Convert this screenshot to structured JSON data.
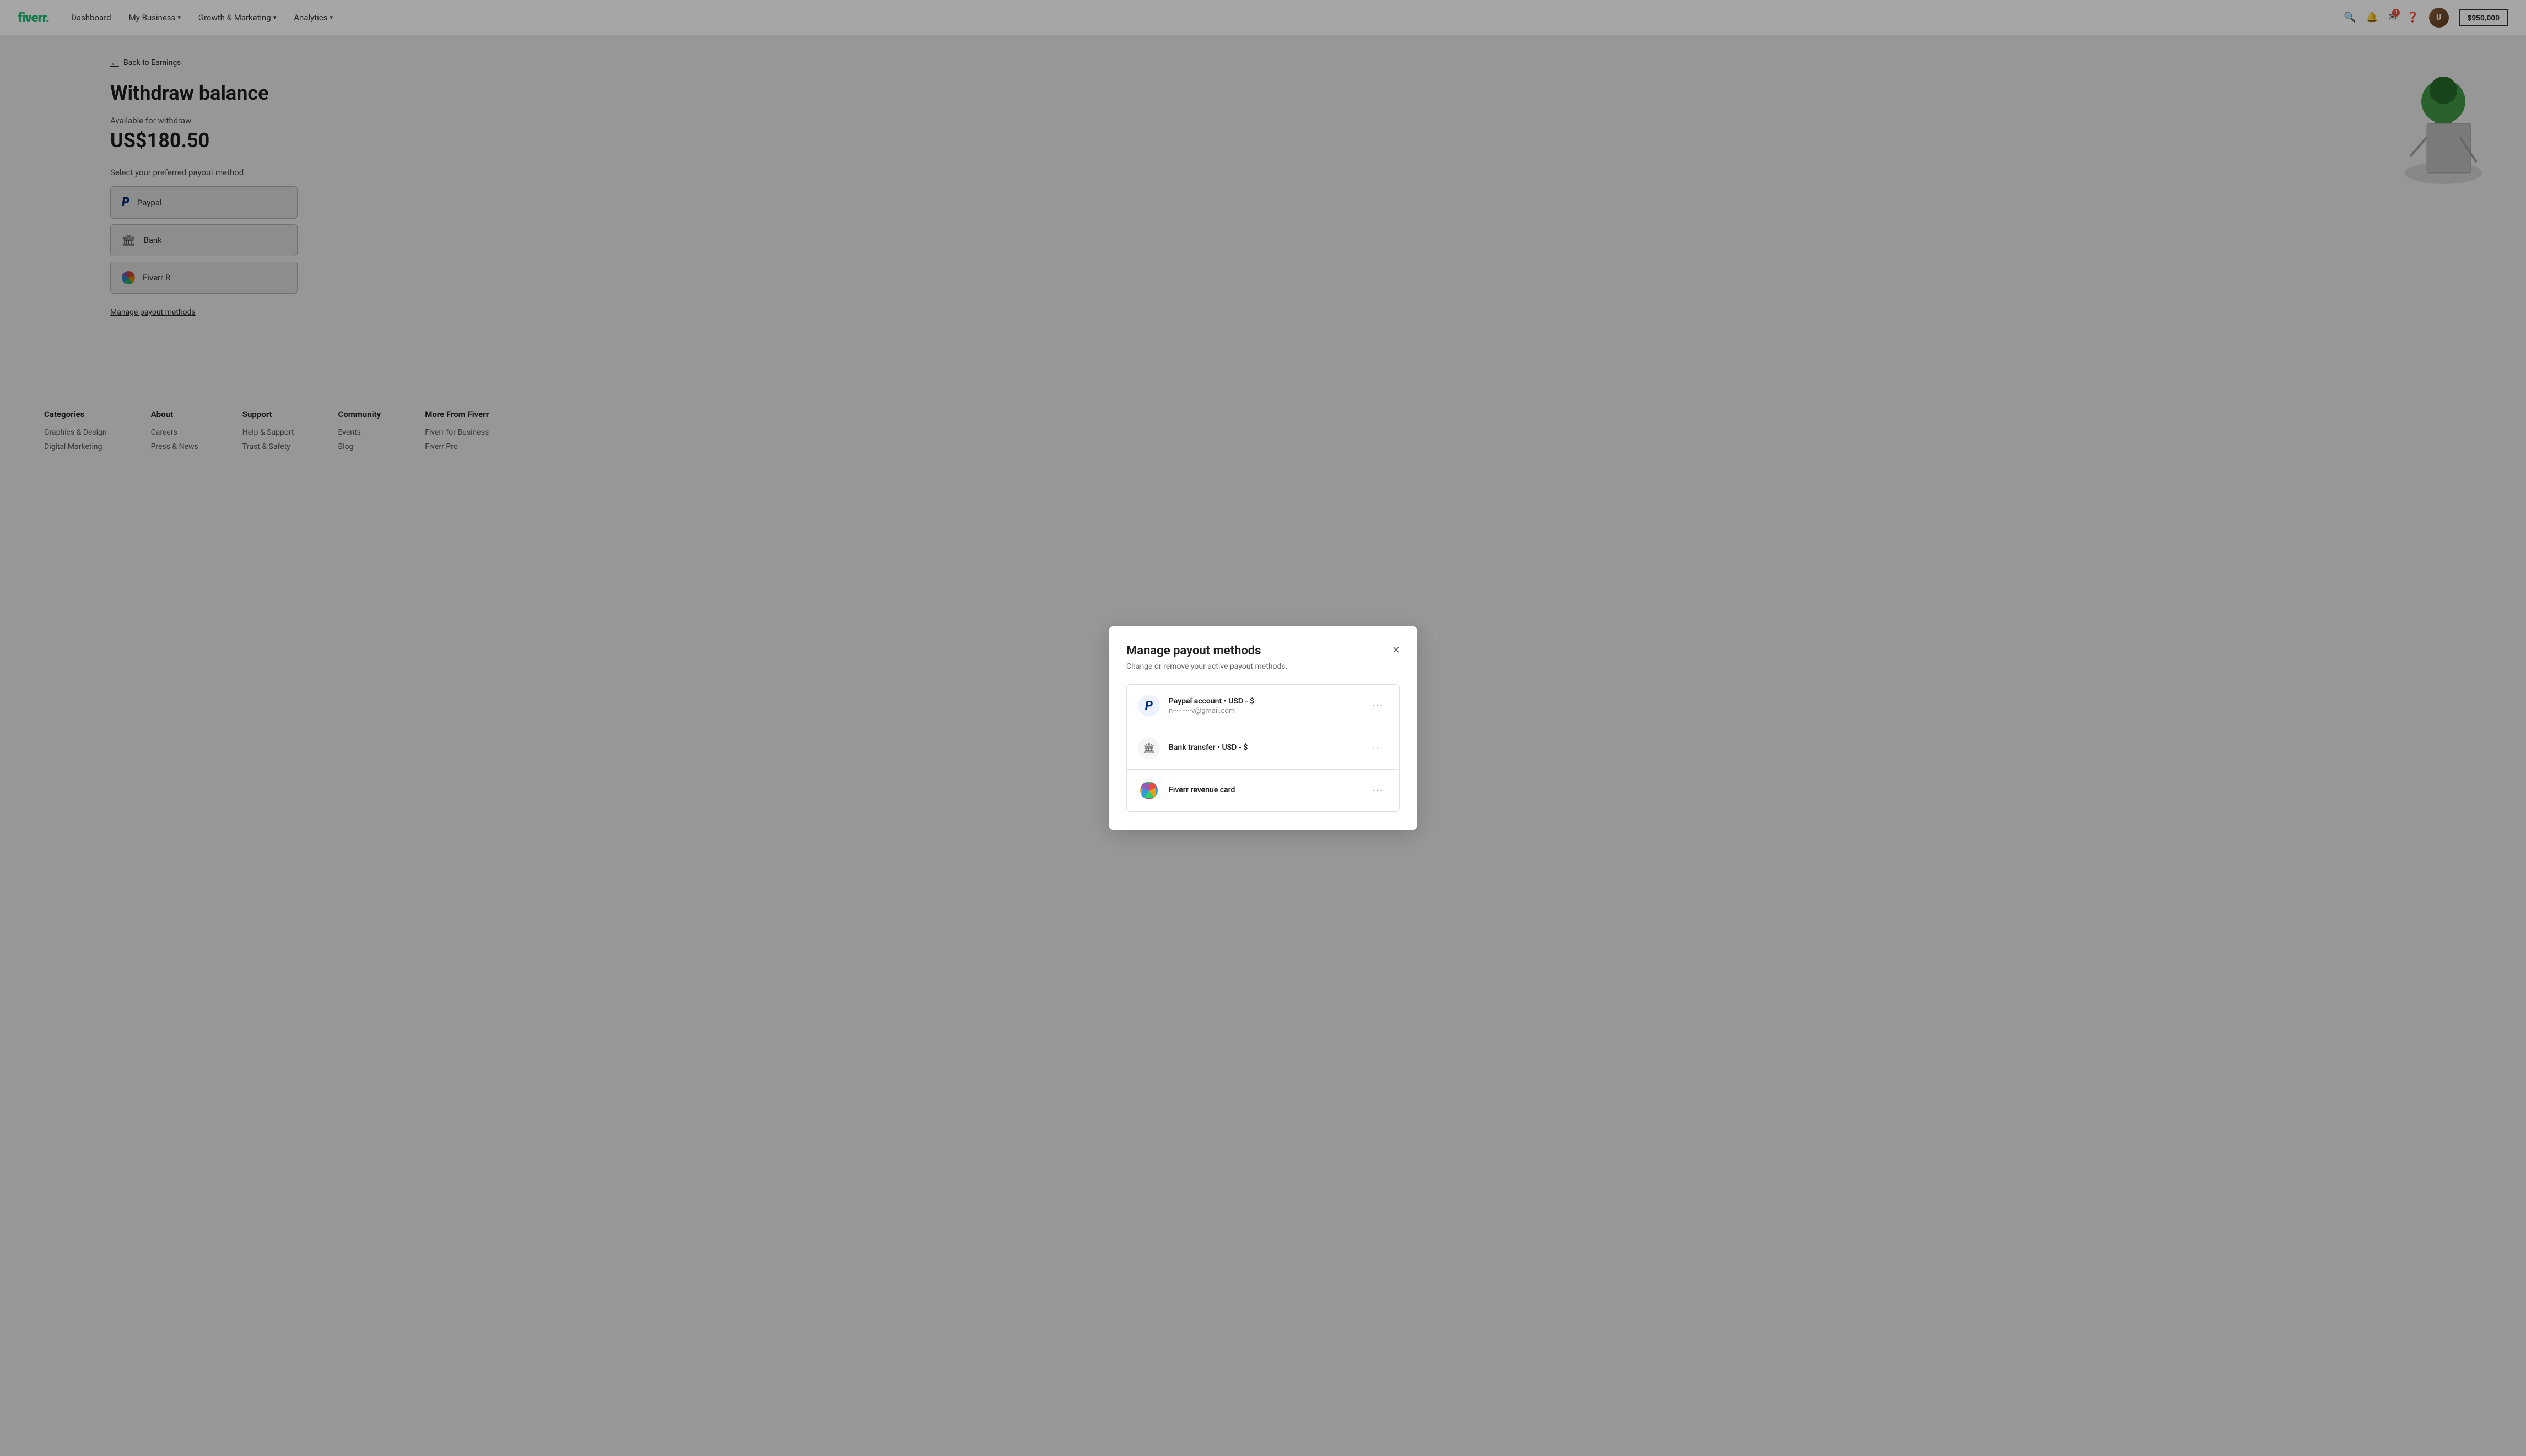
{
  "navbar": {
    "logo": "fiverr.",
    "links": [
      {
        "label": "Dashboard",
        "hasDropdown": false
      },
      {
        "label": "My Business",
        "hasDropdown": true
      },
      {
        "label": "Growth & Marketing",
        "hasDropdown": true
      },
      {
        "label": "Analytics",
        "hasDropdown": true
      }
    ],
    "balance": "$950,000"
  },
  "back_link": "Back to Earnings",
  "page_title": "Withdraw balance",
  "available_label": "Available for withdraw",
  "amount": "US$180.50",
  "select_label": "Select your preferred payout method",
  "payout_options": [
    {
      "label": "Paypal"
    },
    {
      "label": "Bank"
    },
    {
      "label": "Fiverr R"
    }
  ],
  "manage_link": "Manage payout methods",
  "modal": {
    "title": "Manage payout methods",
    "subtitle": "Change or remove your active payout methods.",
    "close_label": "×",
    "items": [
      {
        "type": "paypal",
        "name": "Paypal account • USD - $",
        "detail": "n··········v@gmail.com"
      },
      {
        "type": "bank",
        "name": "Bank transfer • USD - $",
        "detail": ""
      },
      {
        "type": "fiverr",
        "name": "Fiverr revenue card",
        "detail": ""
      }
    ]
  },
  "footer": {
    "columns": [
      {
        "heading": "Categories",
        "links": [
          "Graphics & Design",
          "Digital Marketing"
        ]
      },
      {
        "heading": "About",
        "links": [
          "Careers",
          "Press & News"
        ]
      },
      {
        "heading": "Support",
        "links": [
          "Help & Support",
          "Trust & Safety"
        ]
      },
      {
        "heading": "Community",
        "links": [
          "Events",
          "Blog"
        ]
      },
      {
        "heading": "More From Fiverr",
        "links": [
          "Fiverr for Business",
          "Fiverr Pro"
        ]
      }
    ]
  }
}
